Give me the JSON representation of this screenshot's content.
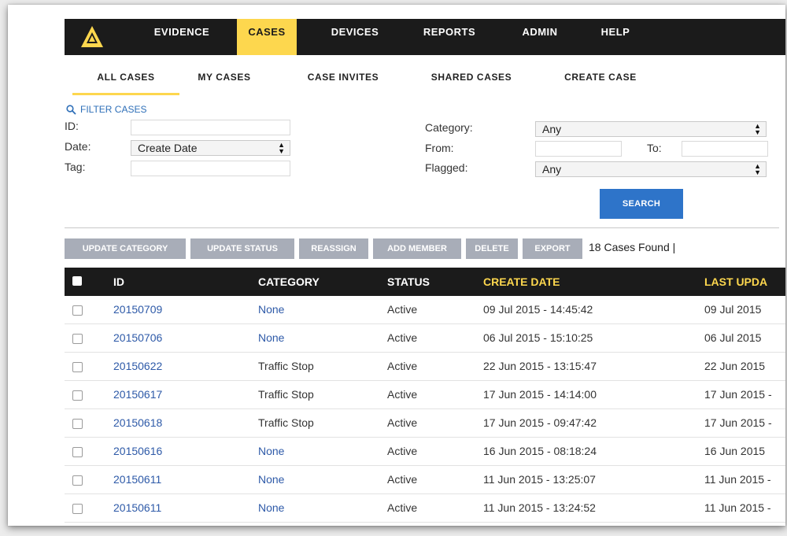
{
  "nav": {
    "items": [
      {
        "label": "EVIDENCE",
        "active": false
      },
      {
        "label": "CASES",
        "active": true
      },
      {
        "label": "DEVICES",
        "active": false
      },
      {
        "label": "REPORTS",
        "active": false
      },
      {
        "label": "ADMIN",
        "active": false
      },
      {
        "label": "HELP",
        "active": false
      }
    ],
    "accent_color": "#fdd74e",
    "bar_color": "#1b1b1b"
  },
  "subtabs": [
    {
      "label": "ALL CASES",
      "active": true
    },
    {
      "label": "MY CASES",
      "active": false
    },
    {
      "label": "CASE INVITES",
      "active": false
    },
    {
      "label": "SHARED CASES",
      "active": false
    },
    {
      "label": "CREATE CASE",
      "active": false
    }
  ],
  "filter": {
    "toggle_label": "FILTER CASES",
    "toggle_icon": "search-icon",
    "id_label": "ID:",
    "date_label": "Date:",
    "date_select": "Create Date",
    "tag_label": "Tag:",
    "category_label": "Category:",
    "category_select": "Any",
    "from_label": "From:",
    "to_label": "To:",
    "flagged_label": "Flagged:",
    "flagged_select": "Any",
    "search_button": "SEARCH",
    "search_color": "#2e74c9"
  },
  "actions": {
    "buttons": [
      "UPDATE CATEGORY",
      "UPDATE STATUS",
      "REASSIGN",
      "ADD MEMBER",
      "DELETE",
      "EXPORT"
    ],
    "found_text": "18 Cases Found  |"
  },
  "table": {
    "headers": [
      "ID",
      "CATEGORY",
      "STATUS",
      "CREATE DATE",
      "LAST UPDA"
    ],
    "rows": [
      {
        "id": "20150709",
        "category": "None",
        "status": "Active",
        "created": "09 Jul 2015 - 14:45:42",
        "updated": "09 Jul 2015"
      },
      {
        "id": "20150706",
        "category": "None",
        "status": "Active",
        "created": "06 Jul 2015 - 15:10:25",
        "updated": "06 Jul 2015"
      },
      {
        "id": "20150622",
        "category": "Traffic Stop",
        "status": "Active",
        "created": "22 Jun 2015 - 13:15:47",
        "updated": "22 Jun 2015"
      },
      {
        "id": "20150617",
        "category": "Traffic Stop",
        "status": "Active",
        "created": "17 Jun 2015 - 14:14:00",
        "updated": "17 Jun 2015 -"
      },
      {
        "id": "20150618",
        "category": "Traffic Stop",
        "status": "Active",
        "created": "17 Jun 2015 - 09:47:42",
        "updated": "17 Jun 2015 -"
      },
      {
        "id": "20150616",
        "category": "None",
        "status": "Active",
        "created": "16 Jun 2015 - 08:18:24",
        "updated": "16 Jun 2015"
      },
      {
        "id": "20150611",
        "category": "None",
        "status": "Active",
        "created": "11 Jun 2015 - 13:25:07",
        "updated": "11 Jun 2015 -"
      },
      {
        "id": "20150611",
        "category": "None",
        "status": "Active",
        "created": "11 Jun 2015 - 13:24:52",
        "updated": "11 Jun 2015 -"
      }
    ],
    "link_color": "#2e5aa8",
    "sort_header_color": "#fdd74e"
  }
}
